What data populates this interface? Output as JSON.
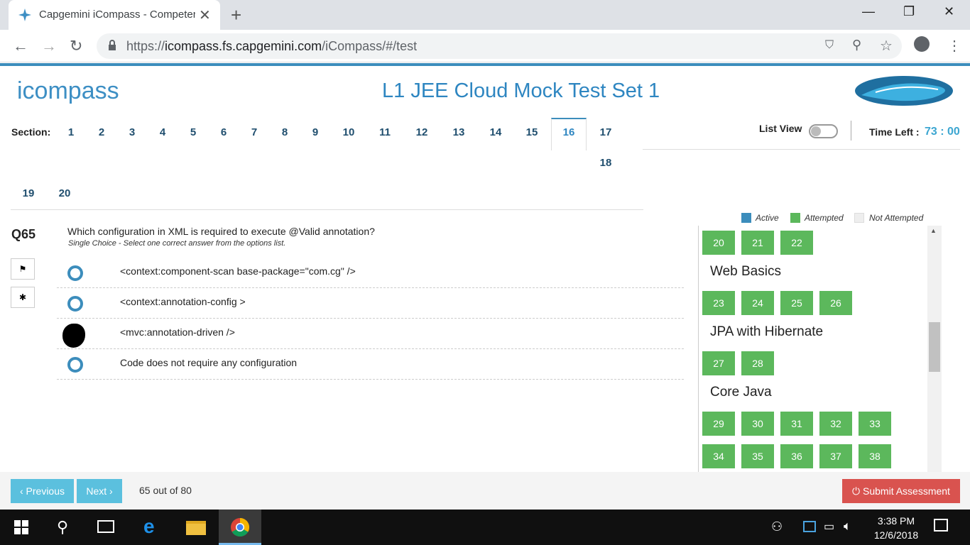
{
  "browser": {
    "tab_title": "Capgemini iCompass - Competer",
    "url_scheme": "https://",
    "url_host": "icompass.fs.capgemini.com",
    "url_path": "/iCompass/#/test",
    "icons": [
      "back-icon",
      "forward-icon",
      "reload-icon",
      "lock-icon",
      "shield-icon",
      "zoom-icon",
      "star-icon",
      "profile-icon",
      "menu-icon"
    ]
  },
  "header": {
    "logo_text": "icompass",
    "test_title": "L1 JEE Cloud Mock Test Set 1"
  },
  "sections": {
    "label": "Section:",
    "items": [
      "1",
      "2",
      "3",
      "4",
      "5",
      "6",
      "7",
      "8",
      "9",
      "10",
      "11",
      "12",
      "13",
      "14",
      "15",
      "16",
      "17",
      "18",
      "19",
      "20"
    ],
    "active": "16"
  },
  "controls": {
    "list_view_label": "List View",
    "list_view_on": false,
    "time_label": "Time Left :",
    "time_value": "73 : 00"
  },
  "question": {
    "number": "Q65",
    "text": "Which configuration in XML is required to execute @Valid annotation?",
    "subtext": "Single Choice - Select one correct answer from the options list.",
    "options": [
      "<context:component-scan base-package=\"com.cg\" />",
      "<context:annotation-config >",
      "<mvc:annotation-driven />",
      "Code does not require any configuration"
    ],
    "selected_index": 2
  },
  "legend": {
    "active": "Active",
    "attempted": "Attempted",
    "not_attempted": "Not Attempted",
    "colors": {
      "active": "#3c8dbc",
      "attempted": "#5cb85c",
      "not_attempted": "#eeeeee"
    }
  },
  "panel": {
    "row0": [
      "20",
      "21",
      "22"
    ],
    "groups": [
      {
        "name": "Web Basics",
        "items": [
          "23",
          "24",
          "25",
          "26"
        ]
      },
      {
        "name": "JPA with Hibernate",
        "items": [
          "27",
          "28"
        ]
      },
      {
        "name": "Core Java",
        "items": [
          "29",
          "30",
          "31",
          "32",
          "33"
        ]
      }
    ],
    "row_last": [
      "34",
      "35",
      "36",
      "37",
      "38"
    ]
  },
  "footer": {
    "prev_label": "‹ Previous",
    "next_label": "Next ›",
    "progress": "65 out of 80",
    "submit_label": "⏻ Submit Assessment"
  },
  "taskbar": {
    "time": "3:38 PM",
    "date": "12/6/2018"
  }
}
